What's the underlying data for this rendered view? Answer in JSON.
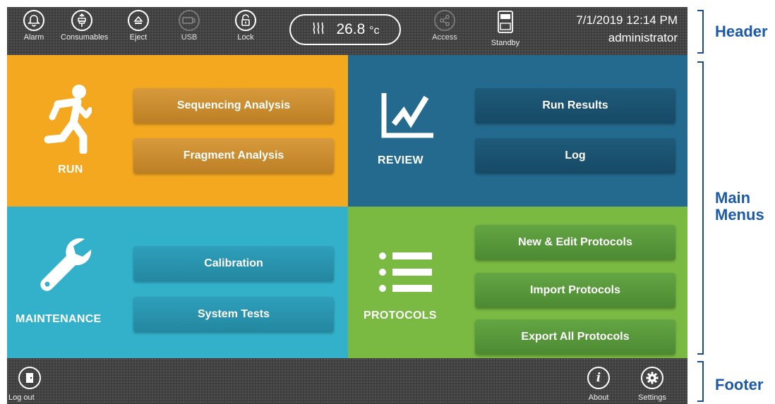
{
  "header": {
    "icons": [
      {
        "name": "alarm",
        "label": "Alarm"
      },
      {
        "name": "consumables",
        "label": "Consumables"
      },
      {
        "name": "eject",
        "label": "Eject"
      },
      {
        "name": "usb",
        "label": "USB"
      },
      {
        "name": "lock",
        "label": "Lock"
      }
    ],
    "temperature": {
      "value": "26.8",
      "unit": "°c"
    },
    "access_label": "Access",
    "standby_label": "Standby",
    "datetime": "7/1/2019 12:14 PM",
    "user": "administrator"
  },
  "menus": {
    "run": {
      "title": "RUN",
      "buttons": [
        "Sequencing Analysis",
        "Fragment Analysis"
      ]
    },
    "review": {
      "title": "REVIEW",
      "buttons": [
        "Run Results",
        "Log"
      ]
    },
    "maintenance": {
      "title": "MAINTENANCE",
      "buttons": [
        "Calibration",
        "System Tests"
      ]
    },
    "protocols": {
      "title": "PROTOCOLS",
      "buttons": [
        "New & Edit Protocols",
        "Import Protocols",
        "Export All Protocols"
      ]
    }
  },
  "footer": {
    "logout_label": "Log out",
    "about_label": "About",
    "settings_label": "Settings"
  },
  "annotations": {
    "header": "Header",
    "main_menus": "Main\nMenus",
    "main_line1": "Main",
    "main_line2": "Menus",
    "footer": "Footer"
  },
  "colors": {
    "run": "#f3a81f",
    "review": "#236a8e",
    "maintenance": "#33b1cb",
    "protocols": "#7ab942",
    "bar": "#3f3f3f",
    "annotation": "#1c5aa8"
  }
}
